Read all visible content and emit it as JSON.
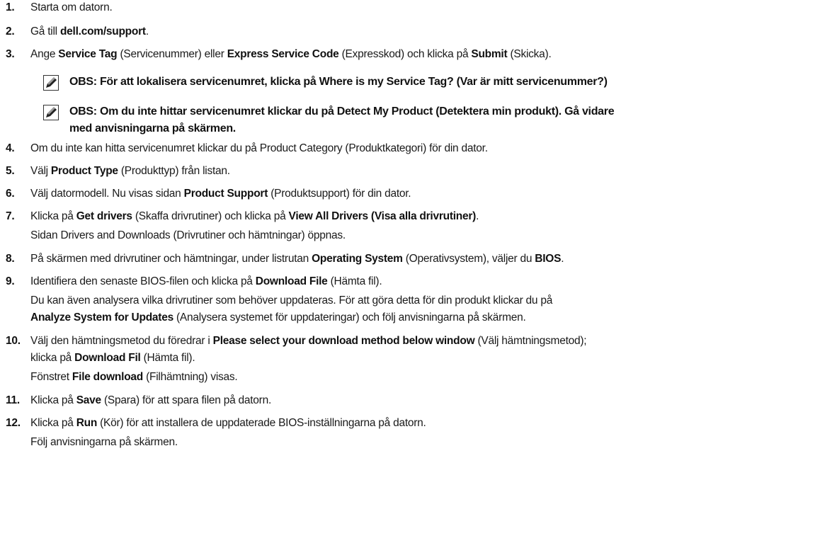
{
  "steps": [
    {
      "num": "1.",
      "parts": [
        {
          "t": "Starta om datorn."
        }
      ]
    },
    {
      "num": "2.",
      "parts": [
        {
          "t": "Gå till "
        },
        {
          "t": "dell.com/support",
          "b": true
        },
        {
          "t": "."
        }
      ]
    },
    {
      "num": "3.",
      "parts": [
        {
          "t": "Ange "
        },
        {
          "t": "Service Tag",
          "b": true
        },
        {
          "t": " (Servicenummer) eller "
        },
        {
          "t": "Express Service Code",
          "b": true
        },
        {
          "t": " (Expresskod) och klicka på "
        },
        {
          "t": "Submit",
          "b": true
        },
        {
          "t": " (Skicka)."
        }
      ]
    },
    {
      "num": "4.",
      "parts": [
        {
          "t": "Om du inte kan hitta servicenumret klickar du på Product Category (Produktkategori) för din dator."
        }
      ]
    },
    {
      "num": "5.",
      "parts": [
        {
          "t": "Välj "
        },
        {
          "t": "Product Type",
          "b": true
        },
        {
          "t": " (Produkttyp) från listan."
        }
      ]
    },
    {
      "num": "6.",
      "parts": [
        {
          "t": "Välj datormodell. Nu visas sidan "
        },
        {
          "t": "Product Support",
          "b": true
        },
        {
          "t": " (Produktsupport) för din dator."
        }
      ]
    },
    {
      "num": "7.",
      "parts": [
        {
          "t": "Klicka på "
        },
        {
          "t": "Get drivers",
          "b": true
        },
        {
          "t": " (Skaffa drivrutiner) och klicka på "
        },
        {
          "t": "View All Drivers (Visa alla drivrutiner)",
          "b": true
        },
        {
          "t": "."
        }
      ]
    },
    {
      "num": "8.",
      "parts": [
        {
          "t": "På skärmen med drivrutiner och hämtningar, under listrutan "
        },
        {
          "t": "Operating System",
          "b": true
        },
        {
          "t": " (Operativsystem), väljer du "
        },
        {
          "t": "BIOS",
          "b": true
        },
        {
          "t": "."
        }
      ]
    },
    {
      "num": "9.",
      "parts": [
        {
          "t": "Identifiera den senaste BIOS-filen och klicka på "
        },
        {
          "t": "Download File",
          "b": true
        },
        {
          "t": " (Hämta fil)."
        }
      ]
    },
    {
      "num": "10.",
      "parts": [
        {
          "t": "Välj den hämtningsmetod du föredrar i "
        },
        {
          "t": "Please select your download method below window",
          "b": true
        },
        {
          "t": " (Välj hämtningsmetod);"
        }
      ]
    },
    {
      "num": "11.",
      "parts": [
        {
          "t": "Klicka på "
        },
        {
          "t": "Save",
          "b": true
        },
        {
          "t": " (Spara) för att spara filen på datorn."
        }
      ]
    },
    {
      "num": "12.",
      "parts": [
        {
          "t": "Klicka på "
        },
        {
          "t": "Run",
          "b": true
        },
        {
          "t": " (Kör) för att installera de uppdaterade BIOS-inställningarna på datorn."
        }
      ]
    }
  ],
  "subs": {
    "s7": [
      {
        "t": "Sidan Drivers and Downloads (Drivrutiner och hämtningar) öppnas."
      }
    ],
    "s9a": [
      {
        "t": "Du kan även analysera vilka drivrutiner som behöver uppdateras. För att göra detta för din produkt klickar du på"
      }
    ],
    "s9b": [
      {
        "t": "Analyze System for Updates",
        "b": true
      },
      {
        "t": " (Analysera systemet för uppdateringar) och följ anvisningarna på skärmen."
      }
    ],
    "s10a": [
      {
        "t": "klicka på "
      },
      {
        "t": "Download Fil",
        "b": true
      },
      {
        "t": " (Hämta fil)."
      }
    ],
    "s10b": [
      {
        "t": "Fönstret "
      },
      {
        "t": "File download",
        "b": true
      },
      {
        "t": " (Filhämtning) visas."
      }
    ],
    "s12": [
      {
        "t": "Följ anvisningarna på skärmen."
      }
    ]
  },
  "notes": {
    "n1": "OBS: För att lokalisera servicenumret, klicka på Where is my Service Tag? (Var är mitt servicenummer?)",
    "n2a": "OBS: Om du inte hittar servicenumret klickar du på Detect My Product (Detektera min produkt). Gå vidare",
    "n2b": "med anvisningarna på skärmen."
  },
  "icons": {
    "note": "pencil-note-icon"
  }
}
